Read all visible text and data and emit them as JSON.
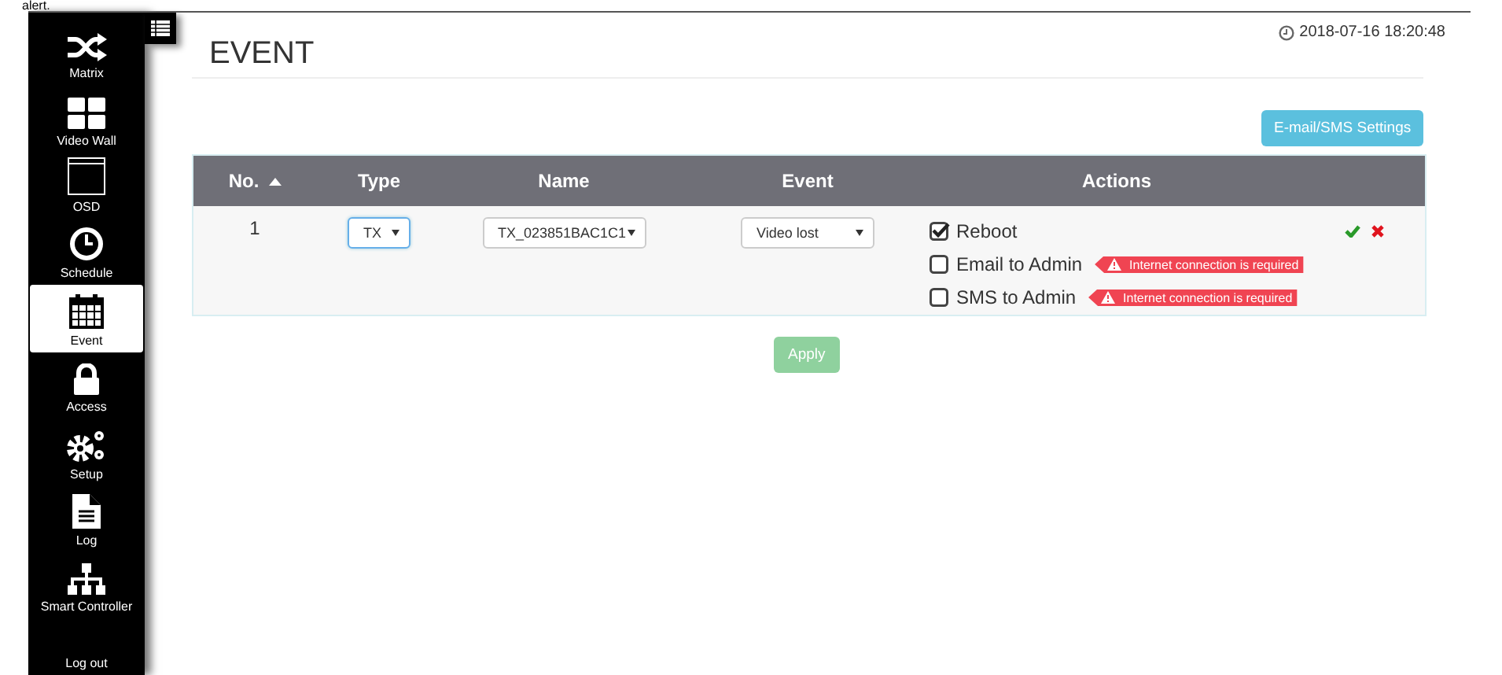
{
  "top_text": "alert.",
  "sidebar": {
    "items": [
      {
        "label": "Matrix",
        "kind": "icon",
        "selected": false
      },
      {
        "label": "Video Wall",
        "kind": "icon",
        "selected": false
      },
      {
        "label": "OSD",
        "kind": "icon",
        "selected": false
      },
      {
        "label": "Schedule",
        "kind": "icon",
        "selected": false
      },
      {
        "label": "Event",
        "kind": "icon",
        "selected": true
      },
      {
        "label": "Access",
        "kind": "icon",
        "selected": false
      },
      {
        "label": "Setup",
        "kind": "icon",
        "selected": false
      },
      {
        "label": "Log",
        "kind": "icon",
        "selected": false
      },
      {
        "label": "Smart Controller",
        "kind": "icon",
        "selected": false
      },
      {
        "label": "Log out",
        "kind": "text",
        "selected": false
      }
    ]
  },
  "header": {
    "title": "EVENT",
    "datetime": "2018-07-16 18:20:48"
  },
  "settings_button": "E-mail/SMS Settings",
  "table": {
    "columns": [
      {
        "label": "No.",
        "sorted": true
      },
      {
        "label": "Type",
        "sorted": false
      },
      {
        "label": "Name",
        "sorted": false
      },
      {
        "label": "Event",
        "sorted": false
      },
      {
        "label": "Actions",
        "sorted": false
      }
    ],
    "rows": [
      {
        "no": "1",
        "type": {
          "value": "TX",
          "focused": true
        },
        "name": {
          "value": "TX_023851BAC1C1",
          "focused": false
        },
        "event": {
          "value": "Video lost",
          "focused": false
        },
        "actions": [
          {
            "label": "Reboot",
            "checked": true
          },
          {
            "label": "Email to Admin",
            "checked": false,
            "warning": "Internet connection is required"
          },
          {
            "label": "SMS to Admin",
            "checked": false,
            "warning": "Internet connection is required"
          }
        ]
      }
    ]
  },
  "apply_button": {
    "label": "Apply",
    "disabled": true
  }
}
